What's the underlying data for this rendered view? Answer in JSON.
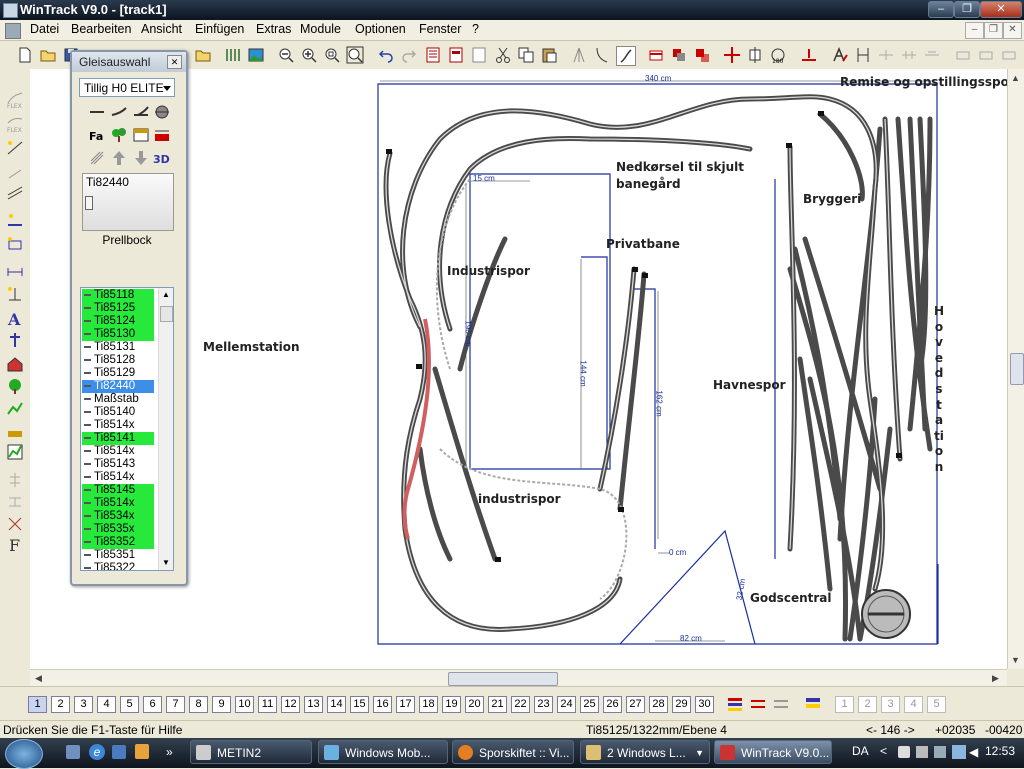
{
  "window": {
    "title": "WinTrack  V9.0 - [track1]"
  },
  "menu": [
    "Datei",
    "Bearbeiten",
    "Ansicht",
    "Einfügen",
    "Extras",
    "Module",
    "Optionen",
    "Fenster",
    "?"
  ],
  "panel": {
    "title": "Gleisauswahl",
    "library": "Tillig H0 ELITE",
    "preview_code": "Ti82440",
    "preview_name": "Prellbock",
    "items": [
      {
        "label": "Ti85118",
        "state": "green"
      },
      {
        "label": "Ti85125",
        "state": "green"
      },
      {
        "label": "Ti85124",
        "state": "green"
      },
      {
        "label": "Ti85130",
        "state": "green"
      },
      {
        "label": "Ti85131",
        "state": "normal"
      },
      {
        "label": "Ti85128",
        "state": "normal"
      },
      {
        "label": "Ti85129",
        "state": "normal"
      },
      {
        "label": "Ti82440",
        "state": "selected"
      },
      {
        "label": "Maßstab",
        "state": "normal"
      },
      {
        "label": "Ti85140",
        "state": "normal"
      },
      {
        "label": "Ti8514x",
        "state": "normal"
      },
      {
        "label": "Ti85141",
        "state": "green"
      },
      {
        "label": "Ti8514x",
        "state": "normal"
      },
      {
        "label": "Ti85143",
        "state": "normal"
      },
      {
        "label": "Ti8514x",
        "state": "normal"
      },
      {
        "label": "Ti85145",
        "state": "green"
      },
      {
        "label": "Ti8514x",
        "state": "green"
      },
      {
        "label": "Ti8534x",
        "state": "green"
      },
      {
        "label": "Ti8535x",
        "state": "green"
      },
      {
        "label": "Ti85352",
        "state": "green"
      },
      {
        "label": "Ti85351",
        "state": "normal"
      },
      {
        "label": "Ti85322",
        "state": "normal"
      }
    ]
  },
  "layout": {
    "labels": {
      "mellemstation": "Mellemstation",
      "remise": "Remise og opstillingsspor",
      "nedkorsel": "Nedkørsel til skjult",
      "banegard": "banegård",
      "bryggeri": "Bryggeri",
      "privatbane": "Privatbane",
      "industrispor1": "Industrispor",
      "havnespor": "Havnespor",
      "industrispor2": "industrispor",
      "godscentral": "Godscentral",
      "hovedstation": "Hovedstation"
    },
    "dims": {
      "top": "340 cm",
      "d15": "15 cm",
      "d190": "190 cm",
      "d144": "144 cm",
      "d162": "162 cm",
      "d0": "0 cm",
      "d32": "32 cm",
      "d82": "82 cm"
    }
  },
  "pages": [
    "1",
    "2",
    "3",
    "4",
    "5",
    "6",
    "7",
    "8",
    "9",
    "10",
    "11",
    "12",
    "13",
    "14",
    "15",
    "16",
    "17",
    "18",
    "19",
    "20",
    "21",
    "22",
    "23",
    "24",
    "25",
    "26",
    "27",
    "28",
    "29",
    "30"
  ],
  "page_selected": "1",
  "extra_pages": [
    "1",
    "2",
    "3",
    "4",
    "5"
  ],
  "status": {
    "help": "Drücken Sie die  F1-Taste für Hilfe",
    "info": "Ti85125/1322mm/Ebene 4",
    "angle": "<- 146 ->",
    "x": "+02035",
    "y": "-00420"
  },
  "taskbar": {
    "tasks": [
      "METIN2",
      "Windows Mob...",
      "Sporskiftet :: Vi...",
      "2 Windows L...",
      "WinTrack V9.0..."
    ],
    "lang": "DA",
    "clock": "12:53"
  }
}
